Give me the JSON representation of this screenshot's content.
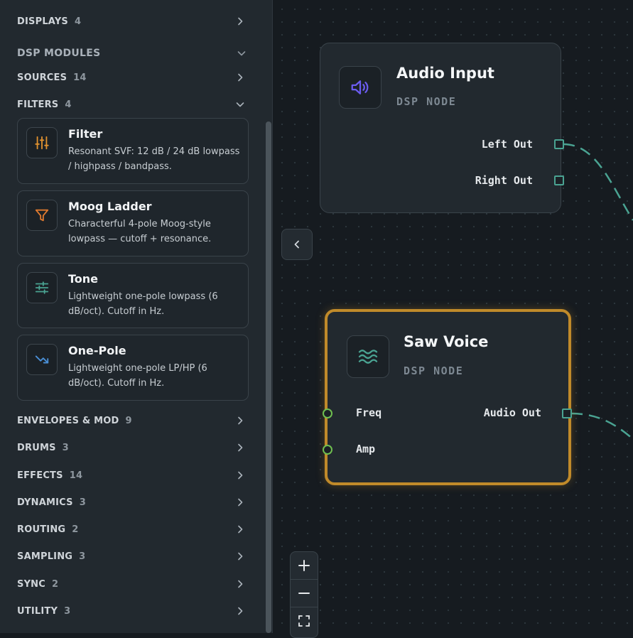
{
  "sidebar": {
    "top_categories": [
      {
        "label": "DISPLAYS",
        "count": "4"
      }
    ],
    "section_title": "DSP MODULES",
    "sources": {
      "label": "SOURCES",
      "count": "14"
    },
    "filters": {
      "label": "FILTERS",
      "count": "4"
    },
    "filter_cards": [
      {
        "icon": "sliders-vertical-icon",
        "title": "Filter",
        "desc": "Resonant SVF: 12 dB / 24 dB lowpass / highpass / bandpass.",
        "icon_color": "#e0912f"
      },
      {
        "icon": "funnel-icon",
        "title": "Moog Ladder",
        "desc": "Characterful 4-pole Moog-style lowpass — cutoff + resonance.",
        "icon_color": "#e07a2f"
      },
      {
        "icon": "sliders-horizontal-icon",
        "title": "Tone",
        "desc": "Lightweight one-pole lowpass (6 dB/oct). Cutoff in Hz.",
        "icon_color": "#4aa392"
      },
      {
        "icon": "trending-down-icon",
        "title": "One-Pole",
        "desc": "Lightweight one-pole LP/HP (6 dB/oct). Cutoff in Hz.",
        "icon_color": "#4a8fd6"
      }
    ],
    "bottom_categories": [
      {
        "label": "ENVELOPES & MOD",
        "count": "9"
      },
      {
        "label": "DRUMS",
        "count": "3"
      },
      {
        "label": "EFFECTS",
        "count": "14"
      },
      {
        "label": "DYNAMICS",
        "count": "3"
      },
      {
        "label": "ROUTING",
        "count": "2"
      },
      {
        "label": "SAMPLING",
        "count": "3"
      },
      {
        "label": "SYNC",
        "count": "2"
      },
      {
        "label": "UTILITY",
        "count": "3"
      }
    ]
  },
  "nodes": {
    "audio_input": {
      "icon": "speaker-icon",
      "title": "Audio Input",
      "subtitle": "DSP NODE",
      "outputs": [
        "Left Out",
        "Right Out"
      ]
    },
    "saw_voice": {
      "icon": "waves-icon",
      "title": "Saw Voice",
      "subtitle": "DSP NODE",
      "inputs": [
        "Freq",
        "Amp"
      ],
      "outputs": [
        "Audio Out"
      ],
      "selected": true
    }
  },
  "colors": {
    "accent_selected": "#c08a2a",
    "output_port": "#4aa392",
    "input_port": "#6fbf50",
    "speaker_icon": "#6b5cf0"
  }
}
